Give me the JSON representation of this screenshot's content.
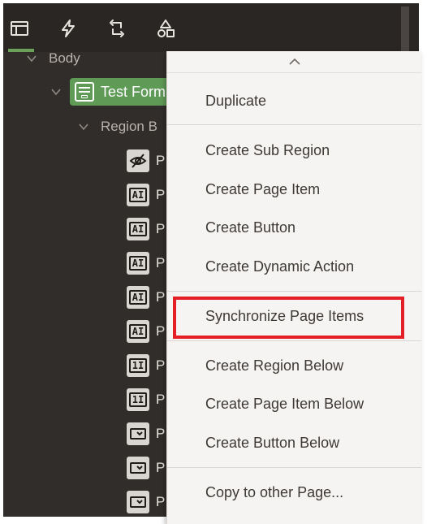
{
  "toolbar": {
    "tabs": [
      {
        "icon": "rendering-tree-icon"
      },
      {
        "icon": "lightning-icon"
      },
      {
        "icon": "refresh-loop-icon"
      },
      {
        "icon": "shapes-icon"
      }
    ],
    "active_color": "#6ba15b"
  },
  "tree": {
    "body_label": "Body",
    "selected_region": "Test Form",
    "region_body_label": "Region B",
    "items": [
      {
        "icon": "hidden",
        "label": "P"
      },
      {
        "icon": "text",
        "label": "P"
      },
      {
        "icon": "text",
        "label": "P"
      },
      {
        "icon": "text",
        "label": "P"
      },
      {
        "icon": "text",
        "label": "P"
      },
      {
        "icon": "text",
        "label": "P"
      },
      {
        "icon": "number",
        "label": "P"
      },
      {
        "icon": "number",
        "label": "P"
      },
      {
        "icon": "select",
        "label": "P"
      },
      {
        "icon": "select",
        "label": "P"
      },
      {
        "icon": "select",
        "label": "P"
      }
    ]
  },
  "menu": {
    "items": [
      "Duplicate",
      "Create Sub Region",
      "Create Page Item",
      "Create Button",
      "Create Dynamic Action",
      "Synchronize Page Items",
      "Create Region Below",
      "Create Page Item Below",
      "Create Button Below",
      "Copy to other Page..."
    ],
    "highlight_color": "#e51e25"
  },
  "icon_text": {
    "text": "AI",
    "number": "1I"
  }
}
